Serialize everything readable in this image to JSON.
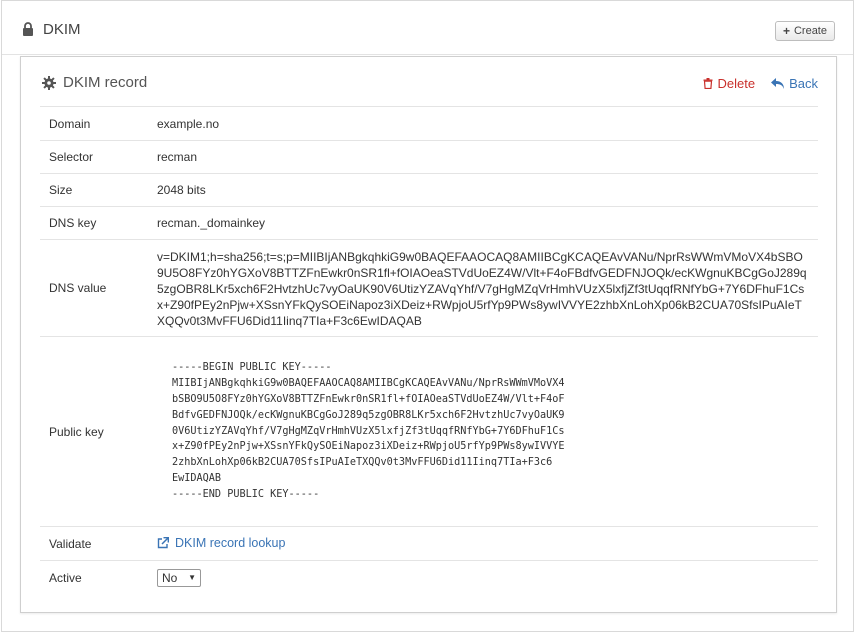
{
  "header": {
    "title": "DKIM",
    "create_label": "Create"
  },
  "panel": {
    "title": "DKIM record",
    "delete_label": "Delete",
    "back_label": "Back"
  },
  "record": {
    "domain": {
      "label": "Domain",
      "value": "example.no"
    },
    "selector": {
      "label": "Selector",
      "value": "recman"
    },
    "size": {
      "label": "Size",
      "value": "2048 bits"
    },
    "dns_key": {
      "label": "DNS key",
      "value": "recman._domainkey"
    },
    "dns_value": {
      "label": "DNS value",
      "value": "v=DKIM1;h=sha256;t=s;p=MIIBIjANBgkqhkiG9w0BAQEFAAOCAQ8AMIIBCgKCAQEAvVANu/NprRsWWmVMoVX4bSBO9U5O8FYz0hYGXoV8BTTZFnEwkr0nSR1fl+fOIAOeaSTVdUoEZ4W/Vlt+F4oFBdfvGEDFNJOQk/ecKWgnuKBCgGoJ289q5zgOBR8LKr5xch6F2HvtzhUc7vyOaUK90V6UtizYZAVqYhf/V7gHgMZqVrHmhVUzX5lxfjZf3tUqqfRNfYbG+7Y6DFhuF1Csx+Z90fPEy2nPjw+XSsnYFkQySOEiNapoz3iXDeiz+RWpjoU5rfYp9PWs8ywIVVYE2zhbXnLohXp06kB2CUA70SfsIPuAIeTXQQv0t3MvFFU6Did11Iinq7TIa+F3c6EwIDAQAB"
    },
    "public_key": {
      "label": "Public key",
      "value": "-----BEGIN PUBLIC KEY-----\nMIIBIjANBgkqhkiG9w0BAQEFAAOCAQ8AMIIBCgKCAQEAvVANu/NprRsWWmVMoVX4\nbSBO9U5O8FYz0hYGXoV8BTTZFnEwkr0nSR1fl+fOIAOeaSTVdUoEZ4W/Vlt+F4oF\nBdfvGEDFNJOQk/ecKWgnuKBCgGoJ289q5zgOBR8LKr5xch6F2HvtzhUc7vyOaUK9\n0V6UtizYZAVqYhf/V7gHgMZqVrHmhVUzX5lxfjZf3tUqqfRNfYbG+7Y6DFhuF1Cs\nx+Z90fPEy2nPjw+XSsnYFkQySOEiNapoz3iXDeiz+RWpjoU5rfYp9PWs8ywIVVYE\n2zhbXnLohXp06kB2CUA70SfsIPuAIeTXQQv0t3MvFFU6Did11Iinq7TIa+F3c6\nEwIDAQAB\n-----END PUBLIC KEY-----"
    },
    "validate": {
      "label": "Validate",
      "link_label": "DKIM record lookup"
    },
    "active": {
      "label": "Active",
      "selected": "No"
    }
  },
  "icons": {
    "lock": "lock-icon",
    "plus": "plus-icon",
    "gear": "gear-icon",
    "trash": "trash-icon",
    "back": "reply-icon",
    "external": "external-link-icon"
  },
  "colors": {
    "danger": "#c9302c",
    "link": "#3a74b5"
  }
}
